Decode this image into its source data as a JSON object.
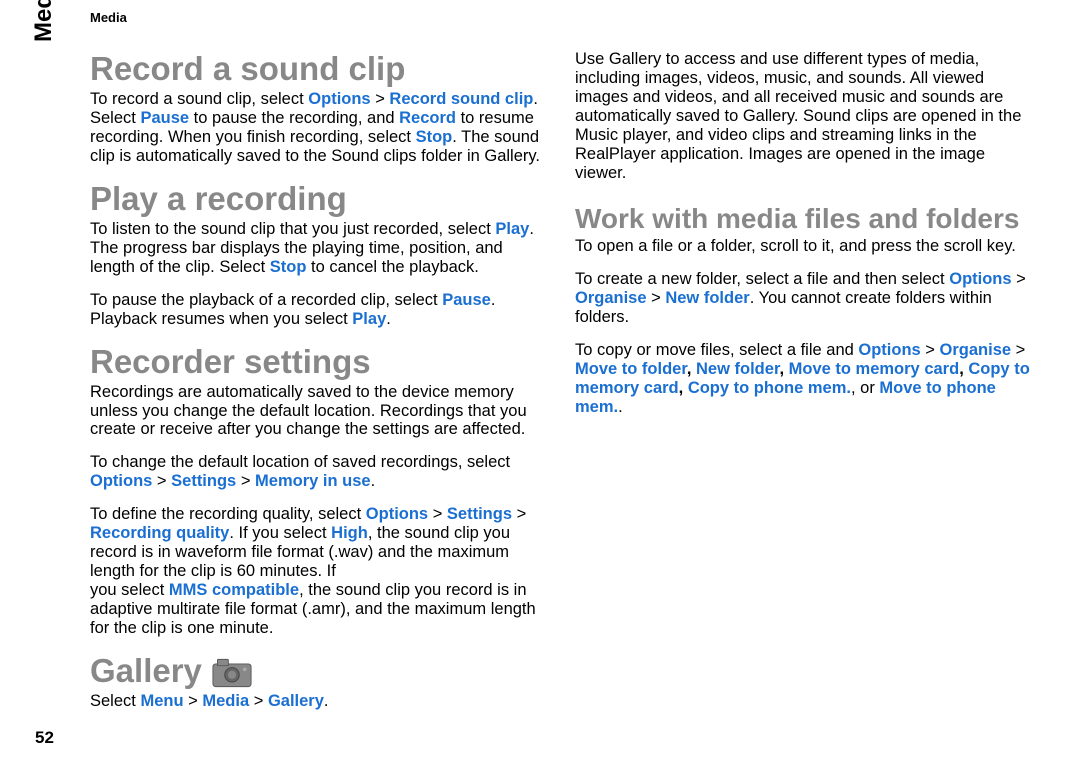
{
  "header_section": "Media",
  "side_label": "Media",
  "page_number": "52",
  "col1": {
    "h1a": "Record a sound clip",
    "p1_pre": "To record a sound clip, select ",
    "p1_opt": "Options",
    "p1_gt1": " > ",
    "p1_rec": "Record sound clip",
    "p1_mid1": ". Select ",
    "p1_pause": "Pause",
    "p1_mid2": " to pause the recording, and ",
    "p1_record": "Record",
    "p1_mid3": " to resume recording. When you finish recording, select ",
    "p1_stop": "Stop",
    "p1_end": ". The sound clip is automatically saved to the Sound clips folder in Gallery.",
    "h1b": "Play a recording",
    "p2_pre": "To listen to the sound clip that you just recorded, select ",
    "p2_play": "Play",
    "p2_mid": ". The progress bar displays the playing time, position, and length of the clip. Select ",
    "p2_stop": "Stop",
    "p2_end": " to cancel the playback.",
    "p3_pre": "To pause the playback of a recorded clip, select ",
    "p3_pause": "Pause",
    "p3_mid": ". Playback resumes when you select ",
    "p3_play": "Play",
    "p3_end": ".",
    "h1c": "Recorder settings",
    "p4": "Recordings are automatically saved to the device memory unless you change the default location. Recordings that you create or receive after you change the settings are affected.",
    "p5_pre": "To change the default location of saved recordings, select ",
    "p5_opt": "Options",
    "p5_gt1": " > ",
    "p5_set": "Settings",
    "p5_gt2": " > ",
    "p5_mem": "Memory in use",
    "p5_end": ".",
    "p6_pre": "To define the recording quality, select ",
    "p6_opt": "Options",
    "p6_gt1": " > ",
    "p6_set": "Settings",
    "p6_gt2": " > ",
    "p6_rq": "Recording quality",
    "p6_mid": ". If you select ",
    "p6_high": "High",
    "p6_end": ", the sound clip you record is in waveform file format (.wav) and the maximum length for the clip is 60 minutes. If "
  },
  "col2": {
    "p7_pre": "you select ",
    "p7_mms": "MMS compatible",
    "p7_end": ", the sound clip you record is in adaptive multirate file format (.amr), and the maximum length for the clip is one minute.",
    "h1d": "Gallery",
    "p8_pre": "Select ",
    "p8_menu": "Menu",
    "p8_gt1": " > ",
    "p8_media": "Media",
    "p8_gt2": " > ",
    "p8_gal": "Gallery",
    "p8_end": ".",
    "p9": "Use Gallery to access and use different types of media, including images, videos, music, and sounds. All viewed images and videos, and all received music and sounds are automatically saved to Gallery. Sound clips are opened in the Music player, and video clips and streaming links in the RealPlayer application. Images are opened in the image viewer.",
    "h2a": "Work with media files and folders",
    "p10": "To open a file or a folder, scroll to it, and press the scroll key.",
    "p11_pre": "To create a new folder, select a file and then select ",
    "p11_opt": "Options",
    "p11_gt1": " > ",
    "p11_org": "Organise",
    "p11_gt2": " > ",
    "p11_nf": "New folder",
    "p11_end": ". You cannot create folders within folders.",
    "p12_pre": "To copy or move files, select a file and ",
    "p12_opt": "Options",
    "p12_gt1": " > ",
    "p12_org": "Organise",
    "p12_gt2": " > ",
    "p12_mtf": "Move to folder",
    "p12_c1": ", ",
    "p12_nf": "New folder",
    "p12_c2": ", ",
    "p12_mmc": "Move to memory card",
    "p12_c3": ", ",
    "p12_cmc": "Copy to memory card",
    "p12_c4": ", ",
    "p12_cpm": "Copy to phone mem.",
    "p12_c5": ", or ",
    "p12_mpm": "Move to phone mem.",
    "p12_end": "."
  }
}
